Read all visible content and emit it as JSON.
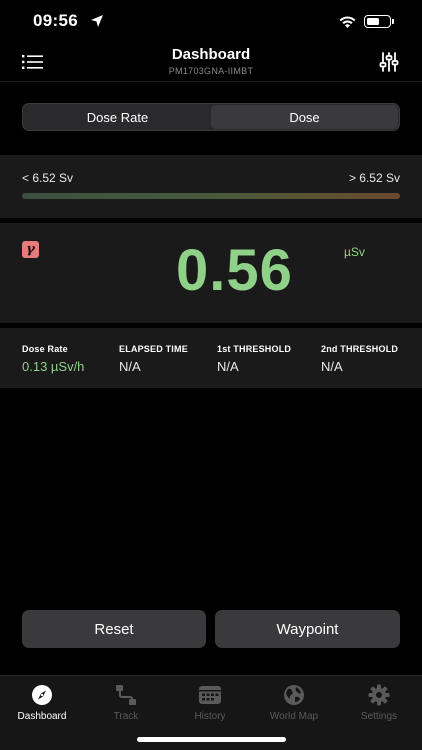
{
  "status_bar": {
    "time": "09:56",
    "battery_fraction": 0.6
  },
  "nav": {
    "title": "Dashboard",
    "subtitle": "PM1703GNA-IIMBT"
  },
  "segments": [
    {
      "label": "Dose Rate",
      "active": false
    },
    {
      "label": "Dose",
      "active": true
    }
  ],
  "threshold_bar": {
    "left_label": "< 6.52 Sv",
    "right_label": "> 6.52 Sv"
  },
  "reading": {
    "badge": "γ",
    "value": "0.56",
    "unit": "µSv"
  },
  "stats": [
    {
      "label": "Dose Rate",
      "value": "0.13 µSv/h",
      "highlight": true
    },
    {
      "label": "ELAPSED TIME",
      "value": "N/A",
      "highlight": false
    },
    {
      "label": "1st THRESHOLD",
      "value": "N/A",
      "highlight": false
    },
    {
      "label": "2nd THRESHOLD",
      "value": "N/A",
      "highlight": false
    }
  ],
  "actions": {
    "reset": "Reset",
    "waypoint": "Waypoint"
  },
  "tabs": [
    {
      "label": "Dashboard",
      "icon": "compass-icon",
      "active": true
    },
    {
      "label": "Track",
      "icon": "track-icon",
      "active": false
    },
    {
      "label": "History",
      "icon": "calendar-icon",
      "active": false
    },
    {
      "label": "World Map",
      "icon": "globe-icon",
      "active": false
    },
    {
      "label": "Settings",
      "icon": "gear-icon",
      "active": false
    }
  ],
  "colors": {
    "accent_green": "#8fd189",
    "gamma_badge": "#e77b7b",
    "button_bg": "#3a3a3c"
  }
}
